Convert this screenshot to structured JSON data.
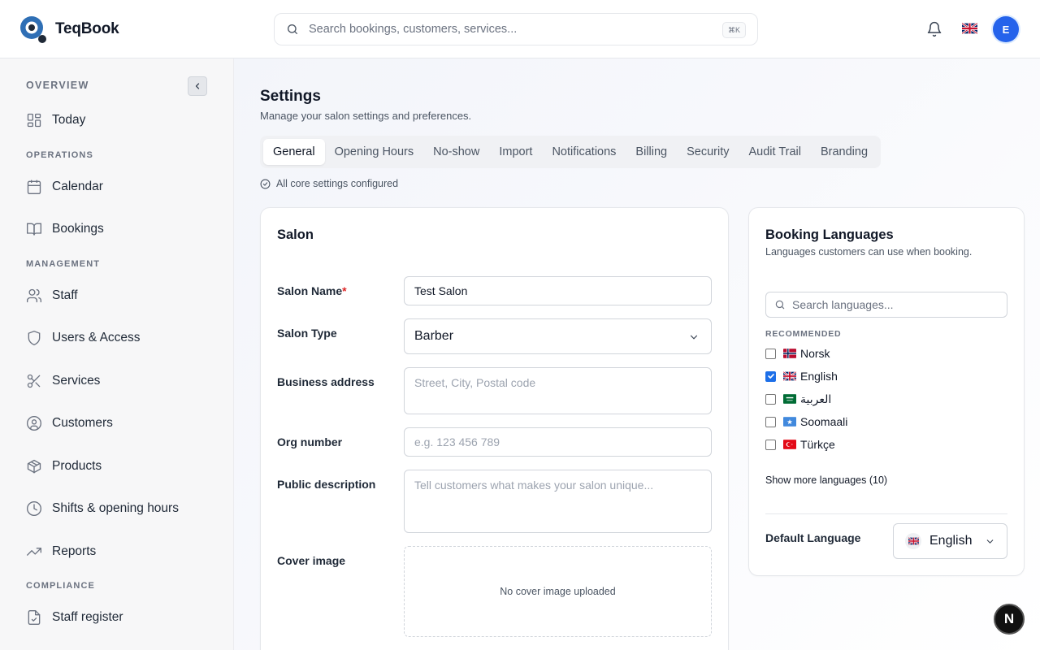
{
  "app": {
    "name": "TeqBook"
  },
  "header": {
    "search_placeholder": "Search bookings, customers, services...",
    "shortcut": "⌘K",
    "avatar_initial": "E"
  },
  "sidebar": {
    "sections": {
      "overview": "OVERVIEW",
      "operations": "OPERATIONS",
      "management": "MANAGEMENT",
      "compliance": "COMPLIANCE"
    },
    "items": [
      {
        "label": "Today",
        "icon": "dashboard-icon"
      },
      {
        "label": "Calendar",
        "icon": "calendar-icon"
      },
      {
        "label": "Bookings",
        "icon": "book-icon"
      },
      {
        "label": "Staff",
        "icon": "users-icon"
      },
      {
        "label": "Users & Access",
        "icon": "shield-icon"
      },
      {
        "label": "Services",
        "icon": "scissors-icon"
      },
      {
        "label": "Customers",
        "icon": "user-circle-icon"
      },
      {
        "label": "Products",
        "icon": "package-icon"
      },
      {
        "label": "Shifts & opening hours",
        "icon": "clock-icon"
      },
      {
        "label": "Reports",
        "icon": "trending-up-icon"
      },
      {
        "label": "Staff register",
        "icon": "file-check-icon"
      }
    ]
  },
  "page": {
    "title": "Settings",
    "subtitle": "Manage your salon settings and preferences.",
    "tabs": [
      "General",
      "Opening Hours",
      "No-show",
      "Import",
      "Notifications",
      "Billing",
      "Security",
      "Audit Trail",
      "Branding"
    ],
    "active_tab": "General",
    "status": "All core settings configured"
  },
  "salon_card": {
    "title": "Salon",
    "fields": {
      "name": {
        "label": "Salon Name",
        "value": "Test Salon",
        "required": "*"
      },
      "type": {
        "label": "Salon Type",
        "value": "Barber"
      },
      "address": {
        "label": "Business address",
        "placeholder": "Street, City, Postal code"
      },
      "org": {
        "label": "Org number",
        "placeholder": "e.g. 123 456 789"
      },
      "description": {
        "label": "Public description",
        "placeholder": "Tell customers what makes your salon unique..."
      },
      "cover": {
        "label": "Cover image",
        "empty_text": "No cover image uploaded"
      }
    }
  },
  "languages_card": {
    "title": "Booking Languages",
    "subtitle": "Languages customers can use when booking.",
    "search_placeholder": "Search languages...",
    "recommended_label": "RECOMMENDED",
    "languages": [
      {
        "label": "Norsk",
        "checked": false,
        "flag": "norway-flag-icon"
      },
      {
        "label": "English",
        "checked": true,
        "flag": "uk-flag-icon"
      },
      {
        "label": "العربية",
        "checked": false,
        "flag": "saudi-flag-icon"
      },
      {
        "label": "Soomaali",
        "checked": false,
        "flag": "somalia-flag-icon"
      },
      {
        "label": "Türkçe",
        "checked": false,
        "flag": "turkey-flag-icon"
      }
    ],
    "show_more": "Show more languages (10)",
    "default_label": "Default Language",
    "default_value": "English"
  },
  "dev_badge": "N",
  "colors": {
    "accent": "#1d6fe8",
    "avatar": "#2563eb",
    "required": "#dc2626"
  }
}
